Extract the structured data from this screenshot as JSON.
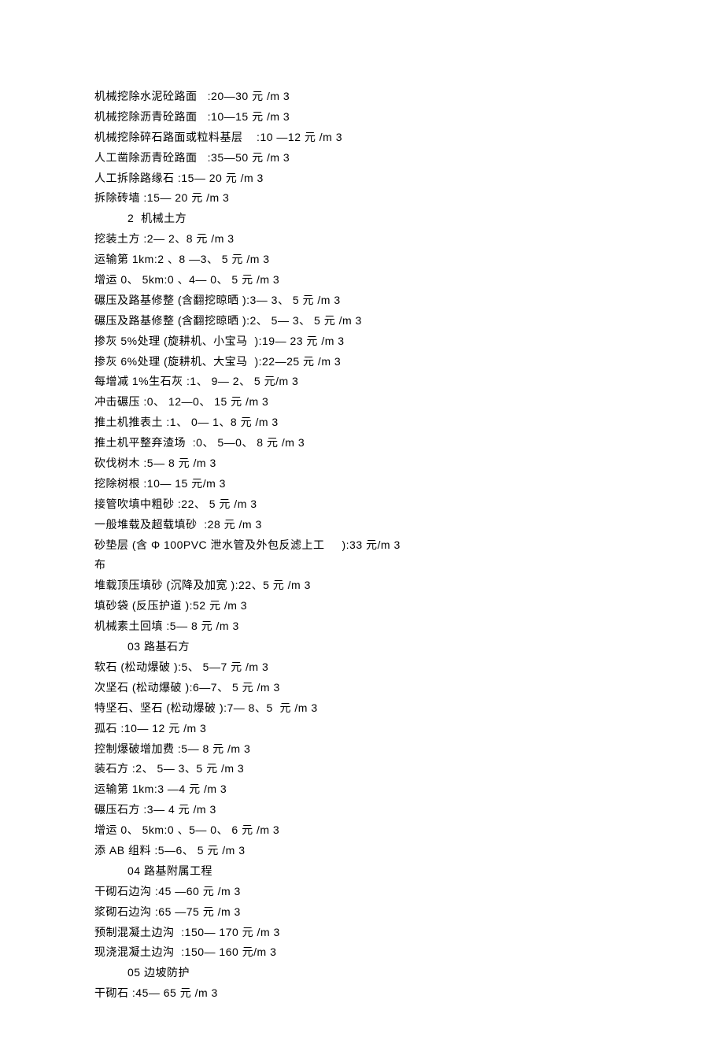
{
  "lines": [
    {
      "cls": "line",
      "text": "机械挖除水泥砼路面   :20—30 元 /m 3"
    },
    {
      "cls": "line",
      "text": "机械挖除沥青砼路面   :10—15 元 /m 3"
    },
    {
      "cls": "line",
      "text": "机械挖除碎石路面或粒料基层    :10 —12 元 /m 3"
    },
    {
      "cls": "line",
      "text": "人工凿除沥青砼路面   :35—50 元 /m 3"
    },
    {
      "cls": "line",
      "text": "人工拆除路缘石 :15— 20 元 /m 3"
    },
    {
      "cls": "line",
      "text": "拆除砖墙 :15— 20 元 /m 3"
    },
    {
      "cls": "line section",
      "text": "2  机械土方"
    },
    {
      "cls": "line",
      "text": "挖装土方 :2— 2、8 元 /m 3"
    },
    {
      "cls": "line",
      "text": "运输第 1km:2 、8 —3、 5 元 /m 3"
    },
    {
      "cls": "line",
      "text": "增运 0、 5km:0 、4— 0、 5 元 /m 3"
    },
    {
      "cls": "line",
      "text": "碾压及路基修整 (含翻挖晾晒 ):3— 3、 5 元 /m 3"
    },
    {
      "cls": "line",
      "text": "碾压及路基修整 (含翻挖晾晒 ):2、 5— 3、 5 元 /m 3"
    },
    {
      "cls": "line",
      "text": "掺灰 5%处理 (旋耕机、小宝马  ):19— 23 元 /m 3"
    },
    {
      "cls": "line",
      "text": "掺灰 6%处理 (旋耕机、大宝马  ):22—25 元 /m 3"
    },
    {
      "cls": "line",
      "text": "每增减 1%生石灰 :1、 9— 2、 5 元/m 3"
    },
    {
      "cls": "line",
      "text": "冲击碾压 :0、 12—0、 15 元 /m 3"
    },
    {
      "cls": "line",
      "text": "推土机推表土 :1、 0— 1、8 元 /m 3"
    },
    {
      "cls": "line",
      "text": "推土机平整弃渣场  :0、 5—0、 8 元 /m 3"
    },
    {
      "cls": "line",
      "text": "砍伐树木 :5— 8 元 /m 3"
    },
    {
      "cls": "line",
      "text": "挖除树根 :10— 15 元/m 3"
    },
    {
      "cls": "line",
      "text": "接管吹填中粗砂 :22、 5 元 /m 3"
    },
    {
      "cls": "line",
      "text": "一般堆载及超载填砂  :28 元 /m 3"
    },
    {
      "cls": "line",
      "text": "砂垫层 (含 Φ 100PVC 泄水管及外包反滤上工     ):33 元/m 3\n布"
    },
    {
      "cls": "line",
      "text": "堆载顶压填砂 (沉降及加宽 ):22、5 元 /m 3"
    },
    {
      "cls": "line",
      "text": "填砂袋 (反压护道 ):52 元 /m 3"
    },
    {
      "cls": "line",
      "text": "机械素土回填 :5— 8 元 /m 3"
    },
    {
      "cls": "line section",
      "text": "03 路基石方"
    },
    {
      "cls": "line",
      "text": "软石 (松动爆破 ):5、 5—7 元 /m 3"
    },
    {
      "cls": "line",
      "text": "次坚石 (松动爆破 ):6—7、 5 元 /m 3"
    },
    {
      "cls": "line",
      "text": "特坚石、坚石 (松动爆破 ):7— 8、5  元 /m 3"
    },
    {
      "cls": "line",
      "text": "孤石 :10— 12 元 /m 3"
    },
    {
      "cls": "line",
      "text": "控制爆破增加费 :5— 8 元 /m 3"
    },
    {
      "cls": "line",
      "text": "装石方 :2、 5— 3、5 元 /m 3"
    },
    {
      "cls": "line",
      "text": "运输第 1km:3 —4 元 /m 3"
    },
    {
      "cls": "line",
      "text": "碾压石方 :3— 4 元 /m 3"
    },
    {
      "cls": "line",
      "text": "增运 0、 5km:0 、5— 0、 6 元 /m 3"
    },
    {
      "cls": "line",
      "text": "添 AB 组料 :5—6、 5 元 /m 3"
    },
    {
      "cls": "line section",
      "text": "04 路基附属工程"
    },
    {
      "cls": "line",
      "text": "干砌石边沟 :45 —60 元 /m 3"
    },
    {
      "cls": "line",
      "text": "浆砌石边沟 :65 —75 元 /m 3"
    },
    {
      "cls": "line",
      "text": "预制混凝土边沟  :150— 170 元 /m 3"
    },
    {
      "cls": "line",
      "text": "现浇混凝土边沟  :150— 160 元/m 3"
    },
    {
      "cls": "line section",
      "text": "05 边坡防护"
    },
    {
      "cls": "line",
      "text": "干砌石 :45— 65 元 /m 3"
    }
  ]
}
